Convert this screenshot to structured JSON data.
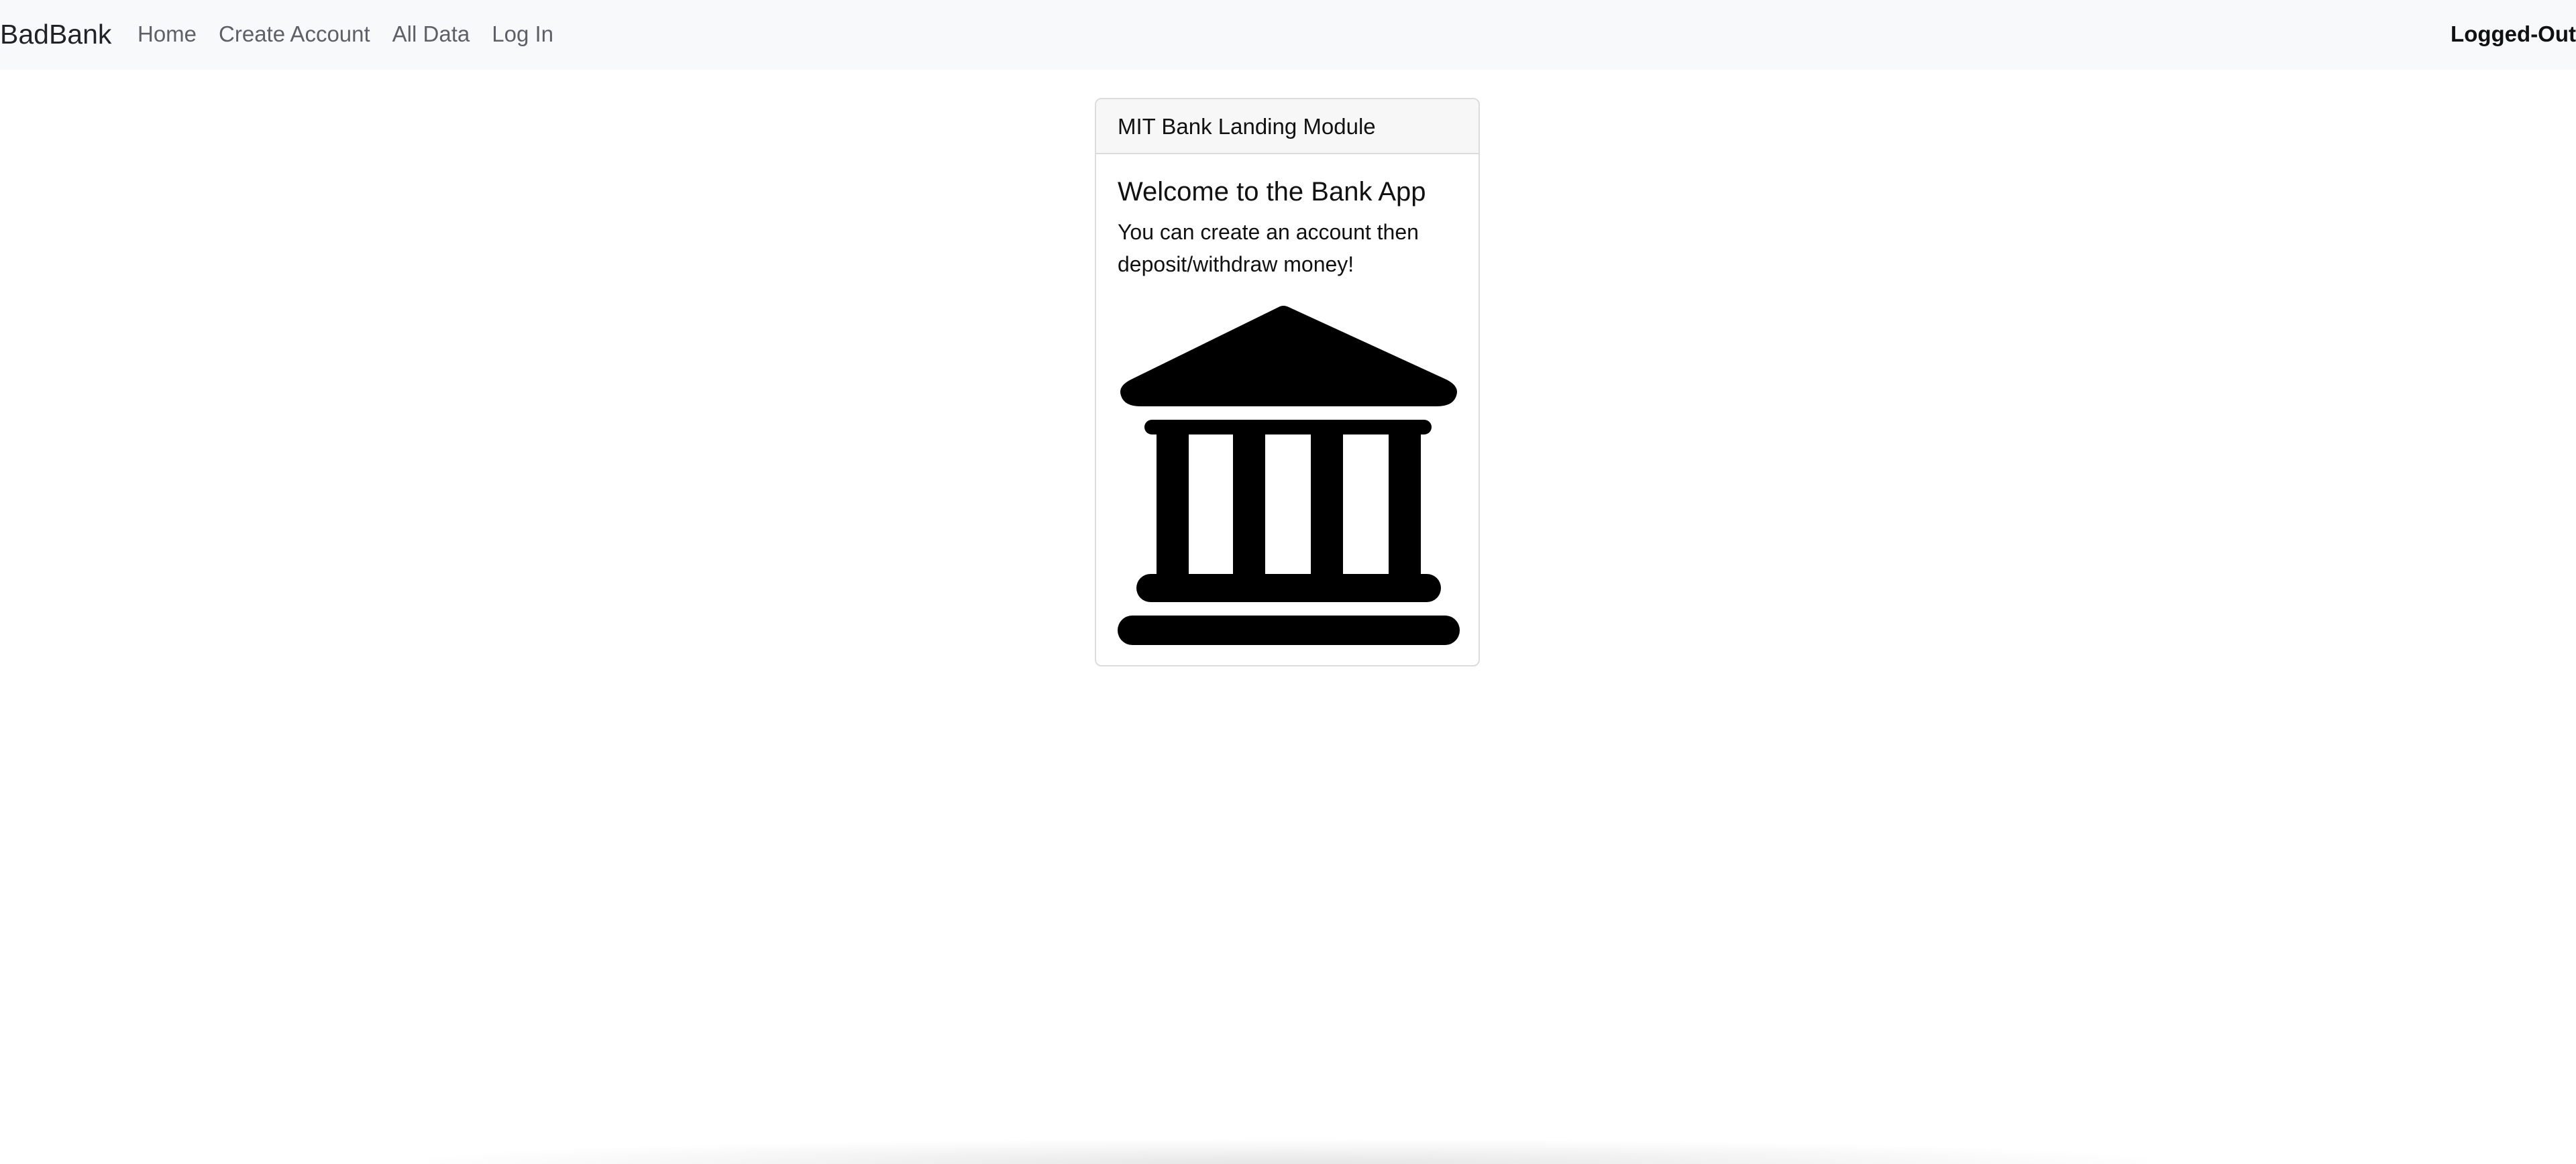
{
  "navbar": {
    "brand": "BadBank",
    "links": [
      {
        "label": "Home"
      },
      {
        "label": "Create Account"
      },
      {
        "label": "All Data"
      },
      {
        "label": "Log In"
      }
    ],
    "status": "Logged-Out"
  },
  "card": {
    "header": "MIT Bank Landing Module",
    "title": "Welcome to the Bank App",
    "text": "You can create an account then deposit/withdraw money!",
    "icon": "bank-building-icon"
  },
  "colors": {
    "navbar_bg": "#f8f9fa",
    "nav_link": "#5d6166",
    "card_border": "#dcdcdc",
    "card_header_bg": "#f7f7f7"
  }
}
